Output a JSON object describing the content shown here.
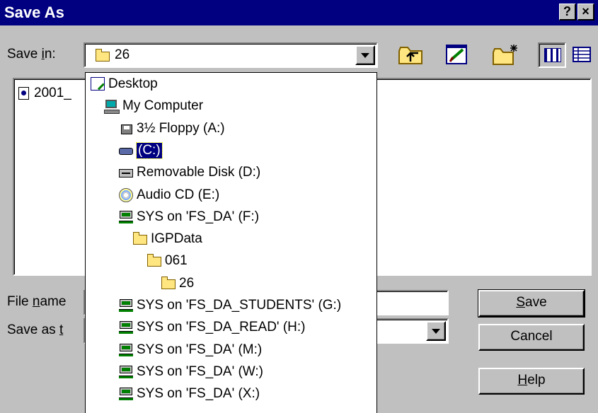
{
  "window": {
    "title": "Save As",
    "help_glyph": "?",
    "close_glyph": "×"
  },
  "save_in": {
    "label_prefix": "Save ",
    "label_accel": "i",
    "label_suffix": "n:",
    "value": "26",
    "icon": "folder-open-icon"
  },
  "toolbar": {
    "up_icon": "up-one-level-icon",
    "desktop_icon": "desktop-icon",
    "new_folder_icon": "new-folder-icon",
    "list_icon": "list-view-icon",
    "details_icon": "details-view-icon"
  },
  "file_list": {
    "items": [
      {
        "name": "2001_",
        "icon": "document-icon"
      }
    ]
  },
  "dropdown": {
    "items": [
      {
        "label": "Desktop",
        "icon": "desktop-icon",
        "indent": 0
      },
      {
        "label": "My Computer",
        "icon": "computer-icon",
        "indent": 1
      },
      {
        "label": "3½ Floppy (A:)",
        "icon": "floppy-icon",
        "indent": 2
      },
      {
        "label": "(C:)",
        "icon": "hard-disk-icon",
        "indent": 2,
        "selected": true
      },
      {
        "label": "Removable Disk (D:)",
        "icon": "removable-disk-icon",
        "indent": 2
      },
      {
        "label": "Audio CD (E:)",
        "icon": "cd-icon",
        "indent": 2
      },
      {
        "label": "SYS on 'FS_DA' (F:)",
        "icon": "network-drive-icon",
        "indent": 2
      },
      {
        "label": "IGPData",
        "icon": "folder-icon",
        "indent": 3
      },
      {
        "label": "061",
        "icon": "folder-icon",
        "indent": 4
      },
      {
        "label": "26",
        "icon": "folder-open-icon",
        "indent": 5
      },
      {
        "label": "SYS on 'FS_DA_STUDENTS' (G:)",
        "icon": "network-drive-icon",
        "indent": 2
      },
      {
        "label": "SYS on 'FS_DA_READ' (H:)",
        "icon": "network-drive-icon",
        "indent": 2
      },
      {
        "label": "SYS on 'FS_DA' (M:)",
        "icon": "network-drive-icon",
        "indent": 2
      },
      {
        "label": "SYS on 'FS_DA' (W:)",
        "icon": "network-drive-icon",
        "indent": 2
      },
      {
        "label": "SYS on 'FS_DA' (X:)",
        "icon": "network-drive-icon",
        "indent": 2
      }
    ]
  },
  "file_name": {
    "label_prefix": "File ",
    "label_accel": "n",
    "label_suffix": "ame",
    "value": ""
  },
  "save_as_type": {
    "label_prefix": "Save as ",
    "label_accel": "t",
    "value": ""
  },
  "buttons": {
    "save": {
      "accel": "S",
      "rest": "ave"
    },
    "cancel": {
      "label": "Cancel"
    },
    "help": {
      "accel": "H",
      "rest": "elp"
    }
  },
  "colors": {
    "title_bar": "#000080",
    "dialog_bg": "#c0c0c0",
    "selection": "#000080"
  }
}
